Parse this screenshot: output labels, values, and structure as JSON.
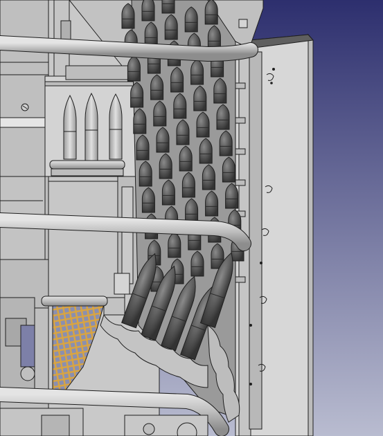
{
  "viewport": {
    "background_top": "#2d2f6e",
    "background_bottom": "#b9bcd0"
  },
  "palette": {
    "body": "#c7c7c7",
    "body_dark": "#a8a8a8",
    "shell": "#555555",
    "shell_dark": "#3c3c3c",
    "shell_light": "#7a7a7a",
    "tube": "#bdbdbd",
    "edge": "#1e1e1e",
    "mesh": "#d9a441",
    "mesh_bg": "#8a8fb0"
  }
}
